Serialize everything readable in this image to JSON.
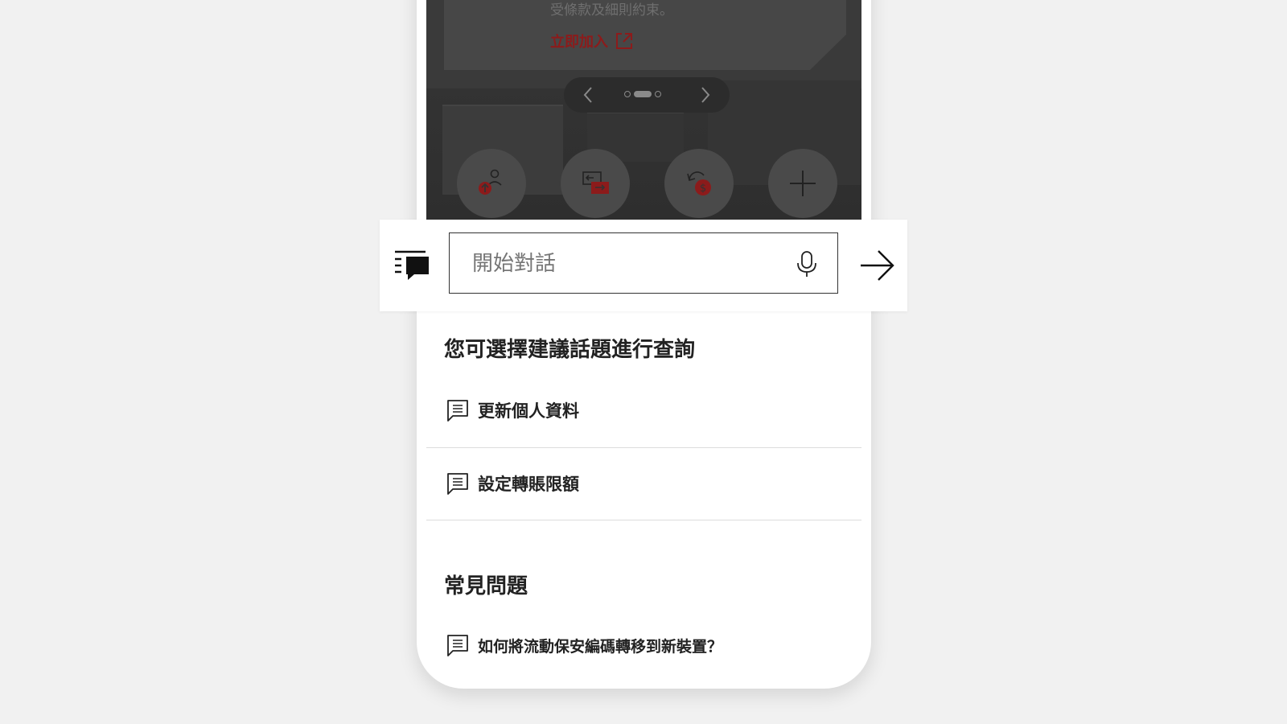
{
  "promo": {
    "terms_text": "受條款及細則約束。",
    "join_label": "立即加入"
  },
  "quick_actions": [
    {
      "icon": "profile-upload-icon"
    },
    {
      "icon": "transfer-icon"
    },
    {
      "icon": "currency-exchange-icon"
    },
    {
      "icon": "plus-icon"
    }
  ],
  "chat": {
    "placeholder": "開始對話"
  },
  "suggestions": {
    "heading": "您可選擇建議話題進行查詢",
    "items": [
      {
        "label": "更新個人資料"
      },
      {
        "label": "設定轉賬限額"
      }
    ]
  },
  "faq": {
    "heading": "常見問題",
    "items": [
      {
        "label": "如何將流動保安編碼轉移到新裝置？"
      }
    ]
  },
  "colors": {
    "accent_red": "#db0011",
    "background": "#f1f1f1"
  }
}
